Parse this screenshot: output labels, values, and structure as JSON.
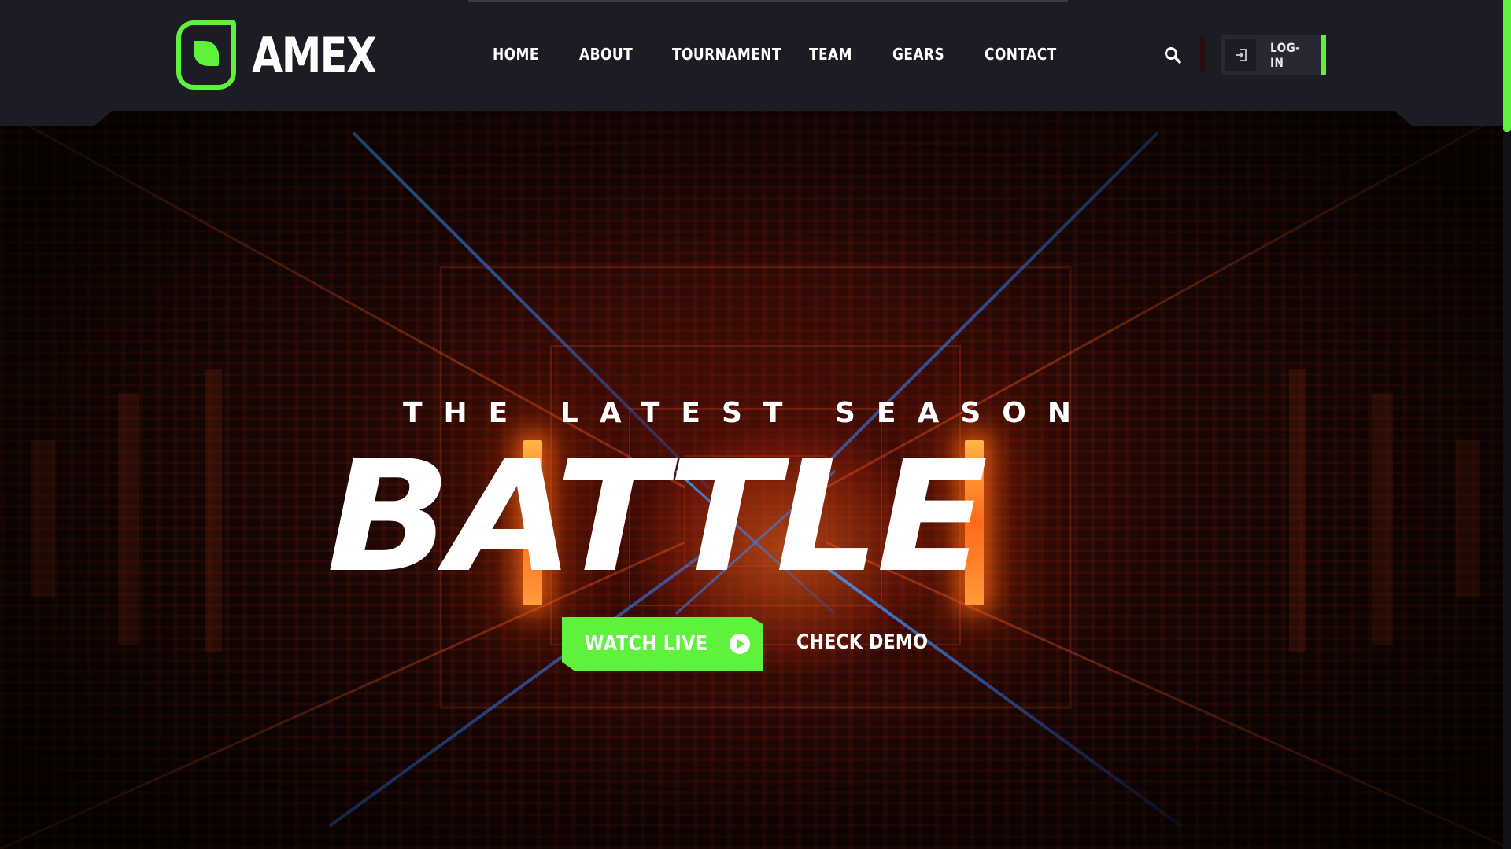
{
  "brand": {
    "name": "AMEX",
    "accent": "#5ef23c",
    "logo_icon": "leaf-logo-icon"
  },
  "nav": {
    "items": [
      {
        "label": "HOME"
      },
      {
        "label": "ABOUT"
      },
      {
        "label": "TOURNAMENT"
      },
      {
        "label": "TEAM"
      },
      {
        "label": "GEARS"
      },
      {
        "label": "CONTACT"
      }
    ]
  },
  "header": {
    "search_icon": "search-icon",
    "login_label": "LOG-IN",
    "login_icon": "sign-in-icon"
  },
  "hero": {
    "subtitle": "THE LATEST SEASON",
    "title": "BATTLE",
    "primary_button": "WATCH LIVE",
    "primary_button_icon": "play-circle-icon",
    "secondary_button": "CHECK DEMO"
  },
  "colors": {
    "header_bg": "#1b1c24",
    "accent": "#5ef23c",
    "hero_glow": "#ff6a1a"
  }
}
